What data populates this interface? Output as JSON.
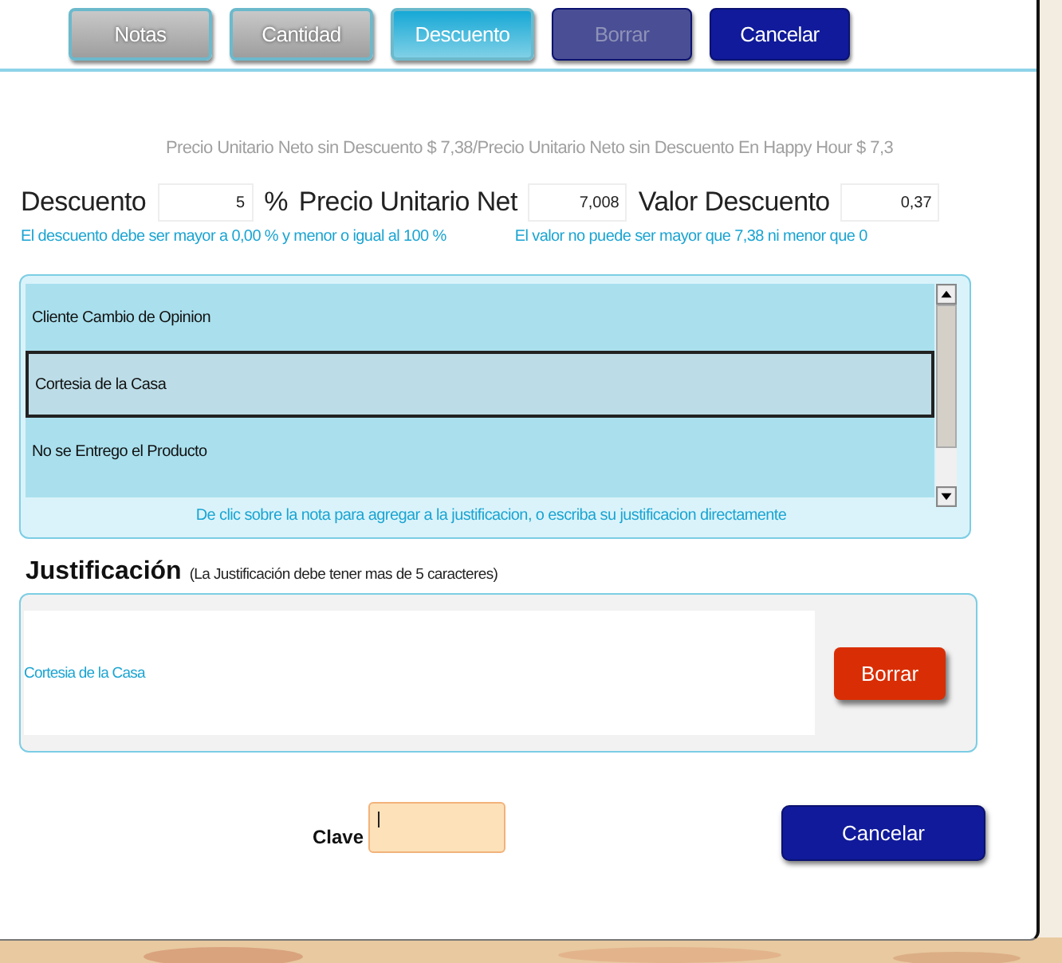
{
  "toolbar": [
    {
      "label": "Notas",
      "kind": "tab",
      "selected": false
    },
    {
      "label": "Cantidad",
      "kind": "tab",
      "selected": false
    },
    {
      "label": "Descuento",
      "kind": "tab",
      "selected": true
    },
    {
      "label": "Borrar",
      "kind": "action",
      "disabled": true
    },
    {
      "label": "Cancelar",
      "kind": "action",
      "disabled": false
    }
  ],
  "price_info": "Precio Unitario Neto sin Descuento $ 7,38/Precio Unitario Neto sin Descuento En Happy Hour $ 7,3",
  "discount": {
    "label": "Descuento",
    "value": "5",
    "unit": "%",
    "hint": "El descuento debe ser mayor a 0,00 % y menor o igual al 100 %"
  },
  "net_price": {
    "label": "Precio Unitario Net",
    "value": "7,008"
  },
  "discount_value": {
    "label": "Valor Descuento",
    "value": "0,37",
    "hint": "El valor no puede ser mayor que 7,38 ni menor que 0"
  },
  "notes": {
    "items": [
      {
        "label": "Cliente Cambio de Opinion",
        "selected": false
      },
      {
        "label": "Cortesia de la Casa",
        "selected": true
      },
      {
        "label": "No se Entrego el Producto",
        "selected": false
      }
    ],
    "hint": "De clic sobre la nota para agregar a la justificacion, o escriba su justificacion directamente"
  },
  "justification": {
    "title": "Justificación",
    "note": "(La Justificación debe tener mas de 5 caracteres)",
    "value": "Cortesia de la Casa",
    "clear_button": "Borrar"
  },
  "password": {
    "label": "Clave"
  },
  "cancel_button": "Cancelar"
}
